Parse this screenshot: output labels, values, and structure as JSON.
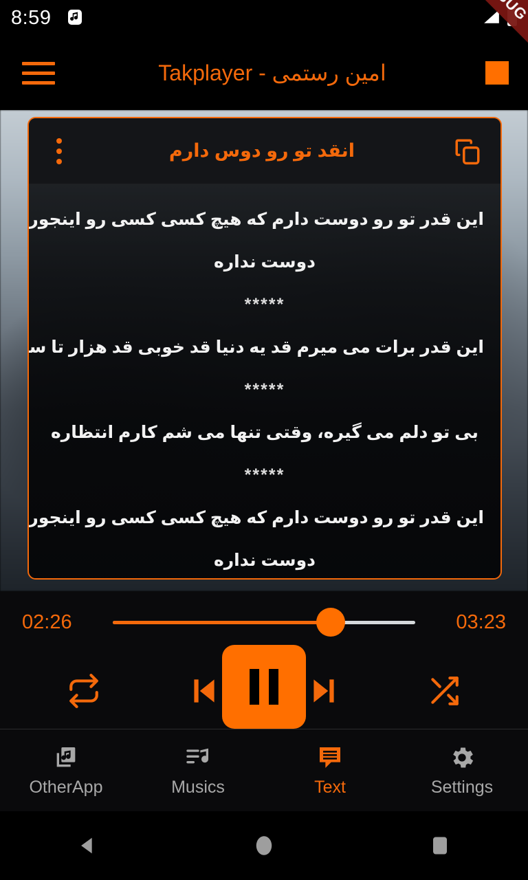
{
  "status_bar": {
    "clock": "8:59",
    "notification_icon": "music-note-icon",
    "signal_icon": "signal-bars-icon",
    "battery_icon": "battery-full-icon"
  },
  "debug_banner": {
    "label": "DEBUG"
  },
  "app_bar": {
    "menu_icon": "hamburger-menu-icon",
    "title": "امین رستمی - Takplayer",
    "action_icon": "stop-square-icon"
  },
  "lyrics_card": {
    "menu_icon": "more-vertical-icon",
    "title": "انقد تو رو دوس دارم",
    "copy_icon": "copy-icon",
    "lines": [
      "این قدر تو رو دوست دارم که هیچ کسی کسی رو اینجوری",
      "دوست نداره",
      "*****",
      "این قدر برات می میرم قد یه دنیا قد خوبی قد هزار تا ستاره",
      "*****",
      "بی تو دلم می گیره، وقتی تنها می شم کارم انتظاره",
      "*****",
      "این قدر تو رو دوست دارم که هیچ کسی کسی رو اینجوری",
      "دوست نداره",
      "*****"
    ]
  },
  "player": {
    "current_time": "02:26",
    "total_time": "03:23",
    "progress_percent": 72,
    "controls": {
      "repeat_icon": "repeat-icon",
      "previous_icon": "skip-previous-icon",
      "play_pause_icon": "pause-icon",
      "next_icon": "skip-next-icon",
      "shuffle_icon": "shuffle-icon"
    }
  },
  "bottom_nav": {
    "items": [
      {
        "label": "OtherApp",
        "icon": "library-music-icon",
        "active": false
      },
      {
        "label": "Musics",
        "icon": "playlist-music-icon",
        "active": false
      },
      {
        "label": "Text",
        "icon": "text-bubble-icon",
        "active": true
      },
      {
        "label": "Settings",
        "icon": "gear-icon",
        "active": false
      }
    ]
  },
  "android_nav": {
    "back_icon": "back-triangle-icon",
    "home_icon": "home-circle-icon",
    "recents_icon": "recents-square-icon"
  },
  "colors": {
    "accent": "#F4690B",
    "accent_bright": "#FF6F00",
    "debug_red": "#7A1712",
    "panel": "#0A0A0C"
  }
}
